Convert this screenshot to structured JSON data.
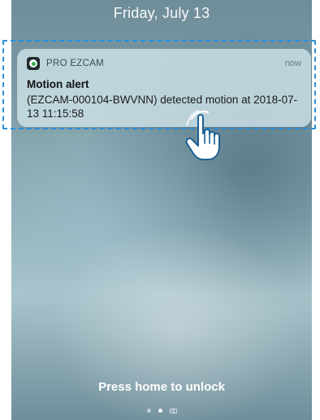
{
  "lockscreen": {
    "date": "Friday, July 13",
    "unlock_hint": "Press home to unlock"
  },
  "notification": {
    "app_name": "PRO EZCAM",
    "app_icon": "eye-icon",
    "time": "now",
    "title": "Motion alert",
    "body": "(EZCAM-000104-BWVNN) detected motion at 2018-07-13 11:15:58"
  },
  "page_indicator": {
    "pages": 3,
    "active_index": 1,
    "last_icon": "camera-icon"
  },
  "colors": {
    "highlight": "#2a8fd8",
    "app_icon_accent": "#35b34a"
  }
}
